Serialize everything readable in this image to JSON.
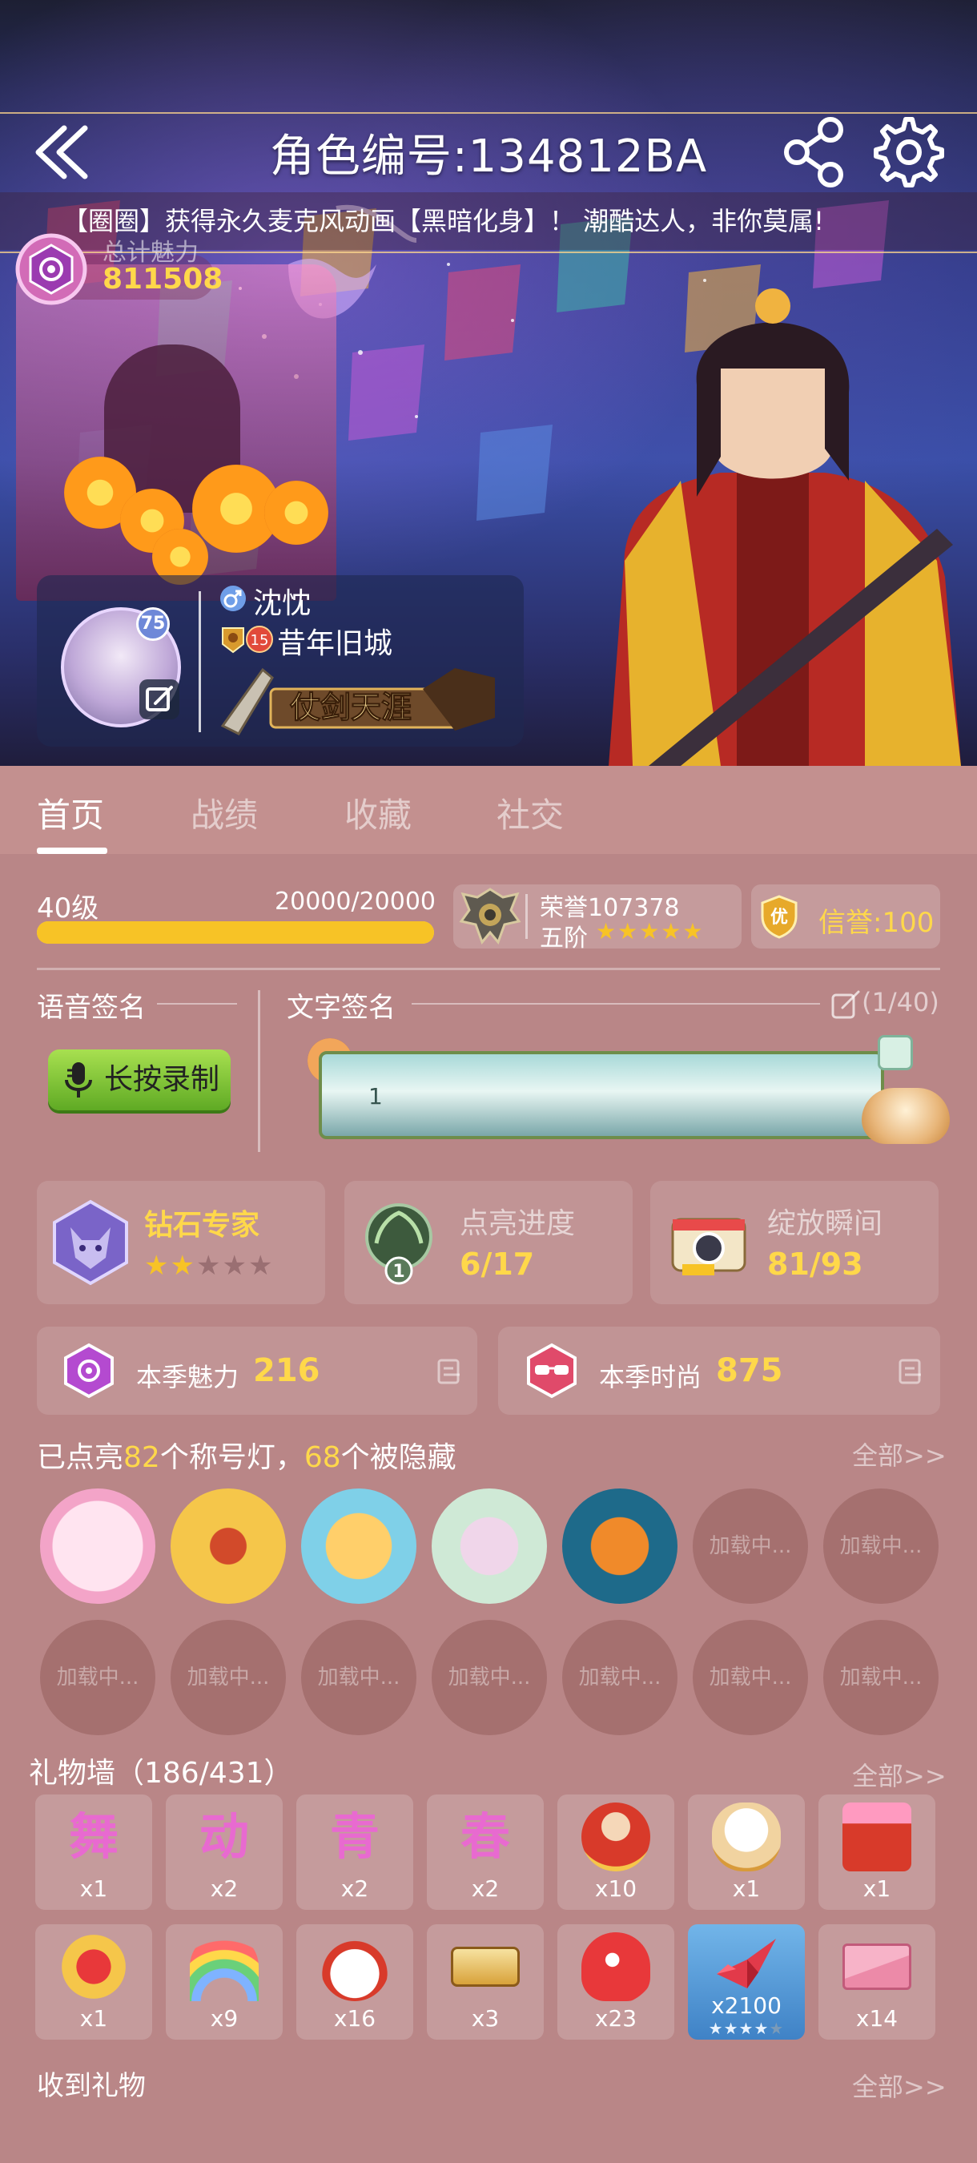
{
  "header": {
    "title": "角色编号:134812BA",
    "marquee": "【圈圈】获得永久麦克风动画【黑暗化身】！ 潮酷达人，非你莫属!",
    "charm_label": "总计魅力",
    "charm_value": "811508"
  },
  "profile": {
    "avatar_level": "75",
    "nickname": "沈忱",
    "guild": "昔年旧城",
    "guild_level": "15",
    "banner_text": "仗剑天涯"
  },
  "tabs": [
    "首页",
    "战绩",
    "收藏",
    "社交"
  ],
  "level": {
    "label": "40级",
    "exp_text": "20000/20000",
    "progress": 1.0
  },
  "honor": {
    "value_text": "荣誉107378",
    "tier": "五阶",
    "stars": "★★★★★"
  },
  "credit": {
    "badge": "优",
    "text": "信誉:100"
  },
  "signature": {
    "voice_label": "语音签名",
    "record_button": "长按录制",
    "text_label": "文字签名",
    "count": "(1/40)",
    "content": "1"
  },
  "stats": [
    {
      "title": "钻石专家",
      "stars_filled": 2,
      "stars_total": 5
    },
    {
      "title": "点亮进度",
      "value": "6/17",
      "badge": "1"
    },
    {
      "title": "绽放瞬间",
      "value": "81/93"
    }
  ],
  "season": {
    "charm_label": "本季魅力",
    "charm_value": "216",
    "fashion_label": "本季时尚",
    "fashion_value": "875"
  },
  "lamps": {
    "title_prefix": "已点亮",
    "lit_count": "82",
    "title_mid": "个称号灯，",
    "hidden_count": "68",
    "title_suffix": "个被隐藏",
    "all_link": "全部>>",
    "loading_text": "加载中..."
  },
  "gifts": {
    "title": "礼物墙（186/431）",
    "all_link": "全部>>",
    "counts": [
      "x1",
      "x2",
      "x2",
      "x2",
      "x10",
      "x1",
      "x1",
      "x1",
      "x9",
      "x16",
      "x3",
      "x23",
      "x2100",
      "x14"
    ],
    "glyphs": [
      "舞",
      "动",
      "青",
      "春"
    ]
  },
  "received": {
    "title": "收到礼物",
    "all_link": "全部>>"
  },
  "colors": {
    "page_bg": "#b98687",
    "accent_gold": "#ffd84a",
    "exp_bar": "#f7c326",
    "record_green": "#7cc235"
  }
}
